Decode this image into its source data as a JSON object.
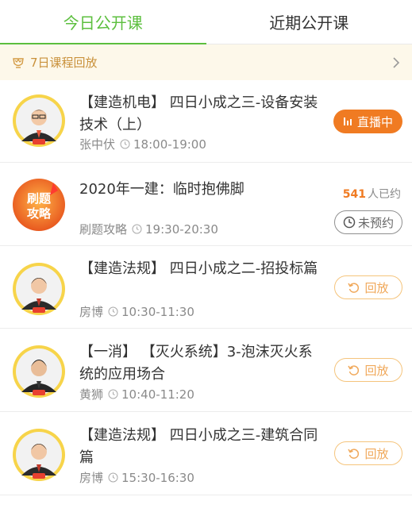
{
  "tabs": [
    {
      "label": "今日公开课",
      "active": true
    },
    {
      "label": "近期公开课",
      "active": false
    }
  ],
  "banner": {
    "text": "7日课程回放",
    "arrow_icon": "chevron-right-icon",
    "icon": "trophy-icon"
  },
  "colors": {
    "accent_green": "#5cbf3e",
    "orange": "#f07b22",
    "banner_bg": "#fdf8ea",
    "banner_text": "#c9913b"
  },
  "courses": [
    {
      "title": "【建造机电】 四日小成之三-设备安装技术（上）",
      "teacher": "张中伏",
      "time": "18:00-19:00",
      "status": "直播中",
      "status_type": "live"
    },
    {
      "title": "2020年一建：临时抱佛脚",
      "teacher": "刷题攻略",
      "time": "19:30-20:30",
      "status": "未预约",
      "status_type": "unbooked",
      "booked_count": "541",
      "booked_suffix": "人已约",
      "avatar_text_1": "刷题",
      "avatar_text_2": "攻略"
    },
    {
      "title": "【建造法规】 四日小成之二-招投标篇",
      "teacher": "房博",
      "time": "10:30-11:30",
      "status": "回放",
      "status_type": "replay"
    },
    {
      "title": "【一消】 【灭火系统】3-泡沫灭火系统的应用场合",
      "teacher": "黄狮",
      "time": "10:40-11:20",
      "status": "回放",
      "status_type": "replay"
    },
    {
      "title": "【建造法规】 四日小成之三-建筑合同篇",
      "teacher": "房博",
      "time": "15:30-16:30",
      "status": "回放",
      "status_type": "replay"
    }
  ]
}
